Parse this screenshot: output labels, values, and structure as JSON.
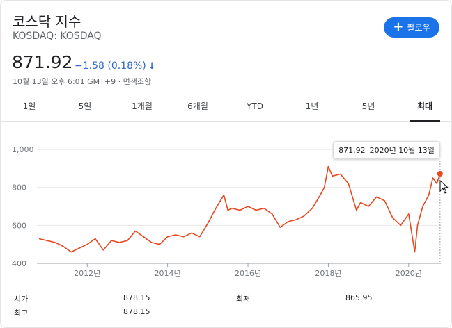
{
  "header": {
    "title": "코스닥 지수",
    "subtitle": "KOSDAQ: KOSDAQ",
    "follow_label": "팔로우"
  },
  "quote": {
    "price": "871.92",
    "change": "−1.58 (0.18%)",
    "timestamp": "10월 13일 오후 6:01 GMT+9 · 면책조항"
  },
  "tabs": [
    {
      "label": "1일"
    },
    {
      "label": "5일"
    },
    {
      "label": "1개월"
    },
    {
      "label": "6개월"
    },
    {
      "label": "YTD"
    },
    {
      "label": "1년"
    },
    {
      "label": "5년"
    },
    {
      "label": "최대"
    }
  ],
  "active_tab": 7,
  "tooltip": {
    "value": "871.92",
    "date": "2020년 10월 13일"
  },
  "stats": {
    "open_label": "시가",
    "open_value": "878.15",
    "low_label": "최저",
    "low_value": "865.95",
    "high_label": "최고",
    "high_value": "878.15"
  },
  "colors": {
    "line": "#e8471f",
    "accent": "#1a73e8",
    "change": "#3366cc"
  },
  "chart_data": {
    "type": "area",
    "x": [
      2010.8,
      2011.0,
      2011.2,
      2011.4,
      2011.6,
      2011.8,
      2012.0,
      2012.2,
      2012.4,
      2012.6,
      2012.8,
      2013.0,
      2013.2,
      2013.4,
      2013.6,
      2013.8,
      2014.0,
      2014.2,
      2014.4,
      2014.6,
      2014.8,
      2015.0,
      2015.2,
      2015.4,
      2015.5,
      2015.6,
      2015.8,
      2016.0,
      2016.2,
      2016.4,
      2016.6,
      2016.8,
      2017.0,
      2017.2,
      2017.4,
      2017.6,
      2017.8,
      2017.9,
      2018.0,
      2018.1,
      2018.3,
      2018.5,
      2018.7,
      2018.8,
      2019.0,
      2019.2,
      2019.4,
      2019.6,
      2019.8,
      2020.0,
      2020.15,
      2020.22,
      2020.35,
      2020.5,
      2020.6,
      2020.7,
      2020.78
    ],
    "y": [
      530,
      520,
      510,
      490,
      460,
      480,
      500,
      530,
      470,
      520,
      510,
      520,
      570,
      540,
      510,
      500,
      540,
      550,
      540,
      560,
      540,
      610,
      690,
      760,
      680,
      690,
      680,
      700,
      680,
      690,
      660,
      590,
      620,
      630,
      650,
      690,
      760,
      800,
      910,
      860,
      870,
      820,
      680,
      720,
      700,
      750,
      730,
      640,
      600,
      660,
      460,
      600,
      700,
      760,
      850,
      820,
      871.92
    ],
    "xticks": [
      "2012년",
      "2014년",
      "2016년",
      "2018년",
      "2020년"
    ],
    "xtick_values": [
      2012,
      2014,
      2016,
      2018,
      2020
    ],
    "yticks": [
      "1,000",
      "800",
      "600",
      "400"
    ],
    "ytick_values": [
      1000,
      800,
      600,
      400
    ],
    "xlim": [
      2010.8,
      2020.8
    ],
    "ylim": [
      400,
      1000
    ],
    "grid": true
  }
}
